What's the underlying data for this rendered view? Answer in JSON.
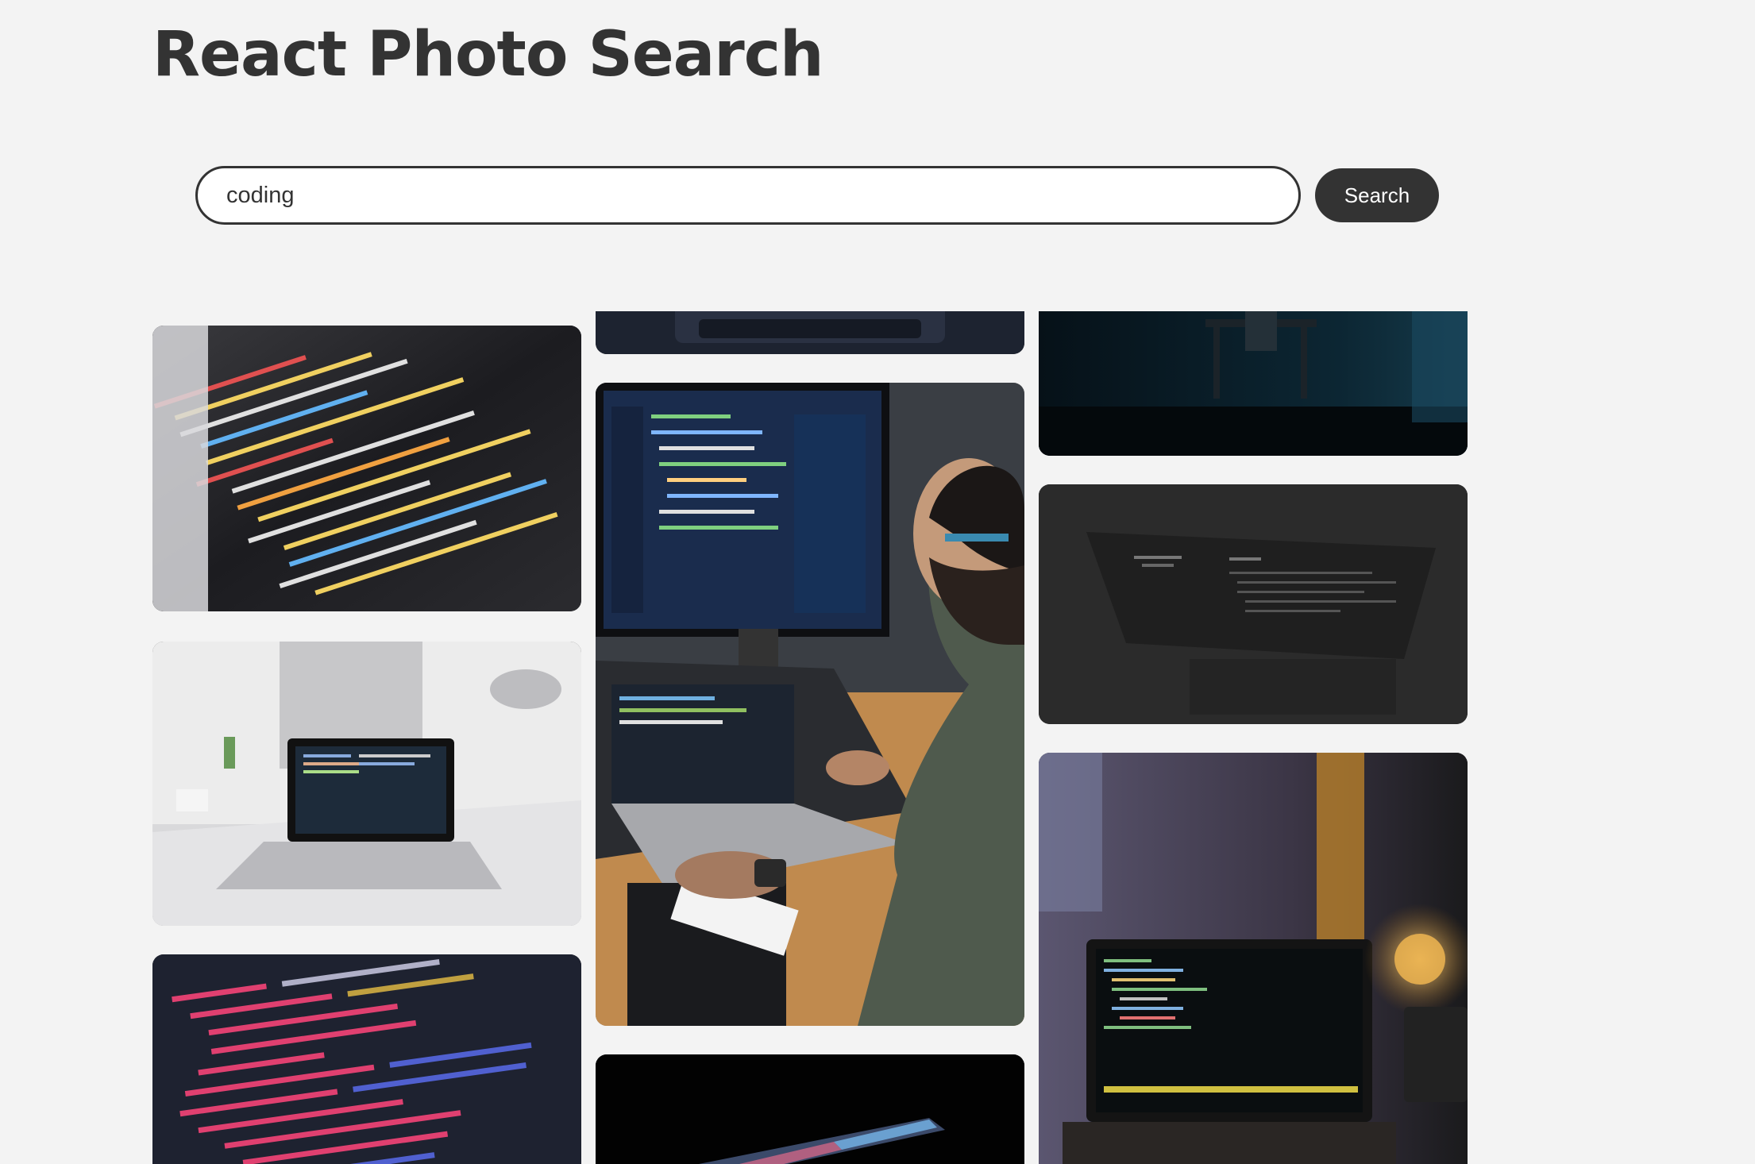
{
  "header": {
    "title": "React Photo Search"
  },
  "search": {
    "value": "coding",
    "placeholder": "",
    "button_label": "Search"
  },
  "gallery": {
    "query": "coding",
    "photos": [
      {
        "subject": "code on screen close-up (php)"
      },
      {
        "subject": "laptop on white desk"
      },
      {
        "subject": "svg code on screen"
      },
      {
        "subject": "laptop keyboard (cropped)"
      },
      {
        "subject": "man coding at monitor and laptop"
      },
      {
        "subject": "laptop glowing in dark"
      },
      {
        "subject": "person at desk in dark blue room"
      },
      {
        "subject": "laptop with code in dark"
      },
      {
        "subject": "laptop by window with lamp"
      }
    ]
  }
}
